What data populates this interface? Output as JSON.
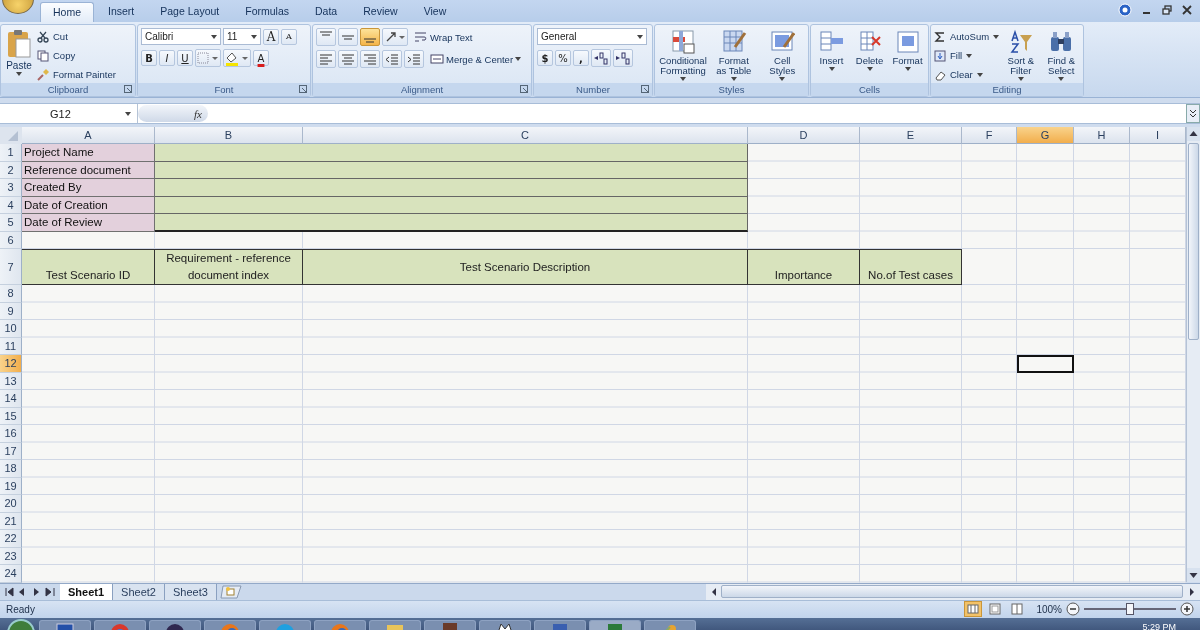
{
  "ribbon_tabs": [
    {
      "label": "Home",
      "selected": true
    },
    {
      "label": "Insert",
      "selected": false
    },
    {
      "label": "Page Layout",
      "selected": false
    },
    {
      "label": "Formulas",
      "selected": false
    },
    {
      "label": "Data",
      "selected": false
    },
    {
      "label": "Review",
      "selected": false
    },
    {
      "label": "View",
      "selected": false
    }
  ],
  "ribbon": {
    "clipboard": {
      "label": "Clipboard",
      "paste": "Paste",
      "small": [
        {
          "label": "Cut",
          "kind": "cut"
        },
        {
          "label": "Copy",
          "kind": "copy"
        },
        {
          "label": "Format Painter",
          "kind": "painter"
        }
      ]
    },
    "font": {
      "label": "Font",
      "font_name": "Calibri",
      "font_size": "11",
      "grow": "A",
      "shrink": "A",
      "bold": "B",
      "italic": "I",
      "underline": "U",
      "font_color": "A"
    },
    "alignment": {
      "label": "Alignment",
      "vertical": [
        {
          "kind": "top",
          "selected": false
        },
        {
          "kind": "middle",
          "selected": false
        },
        {
          "kind": "bottom",
          "selected": true
        }
      ],
      "horizontal": [
        {
          "kind": "left",
          "selected": false
        },
        {
          "kind": "center",
          "selected": false
        },
        {
          "kind": "right",
          "selected": false
        }
      ],
      "wrap_text": "Wrap Text",
      "merge": "Merge & Center"
    },
    "number": {
      "label": "Number",
      "format": "General",
      "currency": "$",
      "percent": "%",
      "comma": ","
    },
    "styles": {
      "label": "Styles",
      "buttons": [
        {
          "label": "Conditional Formatting",
          "kind": "conditional"
        },
        {
          "label": "Format as Table",
          "kind": "table"
        },
        {
          "label": "Cell Styles",
          "kind": "cell"
        }
      ]
    },
    "cells": {
      "label": "Cells",
      "buttons": [
        {
          "label": "Insert",
          "kind": "insert"
        },
        {
          "label": "Delete",
          "kind": "delete"
        },
        {
          "label": "Format",
          "kind": "format"
        }
      ]
    },
    "editing": {
      "label": "Editing",
      "small": [
        {
          "label": "AutoSum",
          "kind": "sum"
        },
        {
          "label": "Fill",
          "kind": "fill"
        },
        {
          "label": "Clear",
          "kind": "clear"
        }
      ],
      "big": [
        {
          "label": "Sort & Filter",
          "kind": "sort"
        },
        {
          "label": "Find & Select",
          "kind": "find"
        }
      ]
    }
  },
  "formula_bar": {
    "name_box": "G12",
    "function_label": "fx"
  },
  "columns": [
    {
      "letter": "A",
      "selected": false
    },
    {
      "letter": "B",
      "selected": false
    },
    {
      "letter": "C",
      "selected": false
    },
    {
      "letter": "D",
      "selected": false
    },
    {
      "letter": "E",
      "selected": false
    },
    {
      "letter": "F",
      "selected": false
    },
    {
      "letter": "G",
      "selected": true
    },
    {
      "letter": "H",
      "selected": false
    },
    {
      "letter": "I",
      "selected": false
    }
  ],
  "rows": [
    {
      "number": "1",
      "selected": false,
      "kind": "info",
      "label": "Project Name"
    },
    {
      "number": "2",
      "selected": false,
      "kind": "info",
      "label": "Reference document"
    },
    {
      "number": "3",
      "selected": false,
      "kind": "info",
      "label": "Created By"
    },
    {
      "number": "4",
      "selected": false,
      "kind": "info",
      "label": "Date of Creation"
    },
    {
      "number": "5",
      "selected": false,
      "kind": "info",
      "label": "Date of Review"
    },
    {
      "number": "6",
      "selected": false,
      "kind": "empty"
    },
    {
      "number": "7",
      "selected": false,
      "kind": "header",
      "cells": [
        "Test Scenario ID",
        "Requirement - reference document index",
        "Test Scenario Description",
        "Importance",
        "No.of Test cases"
      ]
    },
    {
      "number": "8",
      "selected": false,
      "kind": "empty"
    },
    {
      "number": "9",
      "selected": false,
      "kind": "empty"
    },
    {
      "number": "10",
      "selected": false,
      "kind": "empty"
    },
    {
      "number": "11",
      "selected": false,
      "kind": "empty"
    },
    {
      "number": "12",
      "selected": true,
      "kind": "empty"
    },
    {
      "number": "13",
      "selected": false,
      "kind": "empty"
    },
    {
      "number": "14",
      "selected": false,
      "kind": "empty"
    },
    {
      "number": "15",
      "selected": false,
      "kind": "empty"
    },
    {
      "number": "16",
      "selected": false,
      "kind": "empty"
    },
    {
      "number": "17",
      "selected": false,
      "kind": "empty"
    },
    {
      "number": "18",
      "selected": false,
      "kind": "empty"
    },
    {
      "number": "19",
      "selected": false,
      "kind": "empty"
    },
    {
      "number": "20",
      "selected": false,
      "kind": "empty"
    },
    {
      "number": "21",
      "selected": false,
      "kind": "empty"
    },
    {
      "number": "22",
      "selected": false,
      "kind": "empty"
    },
    {
      "number": "23",
      "selected": false,
      "kind": "empty"
    },
    {
      "number": "24",
      "selected": false,
      "kind": "empty"
    }
  ],
  "sheet_tabs": [
    {
      "label": "Sheet1",
      "selected": true
    },
    {
      "label": "Sheet2",
      "selected": false
    },
    {
      "label": "Sheet3",
      "selected": false
    }
  ],
  "status_bar": {
    "text": "Ready",
    "views": [
      {
        "kind": "normal",
        "selected": true
      },
      {
        "kind": "layout",
        "selected": false
      },
      {
        "kind": "break",
        "selected": false
      }
    ],
    "zoom": "100%",
    "zoom_slider": {
      "level": 0.5
    }
  },
  "taskbar": {
    "clock": "5:29 PM"
  }
}
